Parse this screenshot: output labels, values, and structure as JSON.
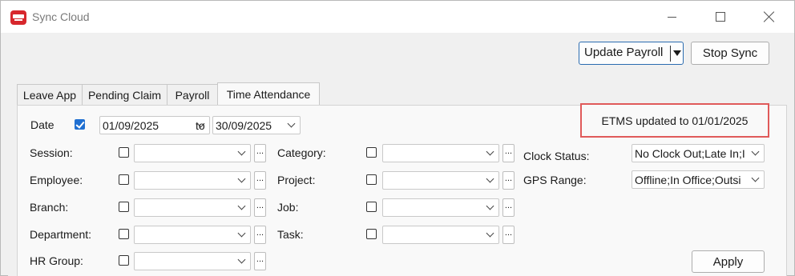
{
  "window": {
    "title": "Sync Cloud",
    "accent_color": "#d7272d"
  },
  "toolbar": {
    "update_payroll_label": "Update Payroll",
    "stop_sync_label": "Stop Sync"
  },
  "tabs": [
    {
      "label": "Leave App",
      "active": false
    },
    {
      "label": "Pending Claim",
      "active": false
    },
    {
      "label": "Payroll",
      "active": false
    },
    {
      "label": "Time Attendance",
      "active": true
    }
  ],
  "date_filter": {
    "label": "Date",
    "checked": true,
    "from": "01/09/2025",
    "to_label": "to",
    "to": "30/09/2025"
  },
  "status": {
    "text": "ETMS updated to 01/01/2025",
    "highlight_color": "#e05a5a"
  },
  "filters_left": [
    {
      "label": "Session:",
      "value": ""
    },
    {
      "label": "Employee:",
      "value": ""
    },
    {
      "label": "Branch:",
      "value": ""
    },
    {
      "label": "Department:",
      "value": ""
    },
    {
      "label": "HR Group:",
      "value": ""
    }
  ],
  "filters_mid": [
    {
      "label": "Category:",
      "value": ""
    },
    {
      "label": "Project:",
      "value": ""
    },
    {
      "label": "Job:",
      "value": ""
    },
    {
      "label": "Task:",
      "value": ""
    }
  ],
  "filters_right": [
    {
      "label": "Clock Status:",
      "value": "No Clock Out;Late In;I"
    },
    {
      "label": "GPS Range:",
      "value": "Offline;In Office;Outsi"
    }
  ],
  "ellipsis": "...",
  "apply_label": "Apply"
}
